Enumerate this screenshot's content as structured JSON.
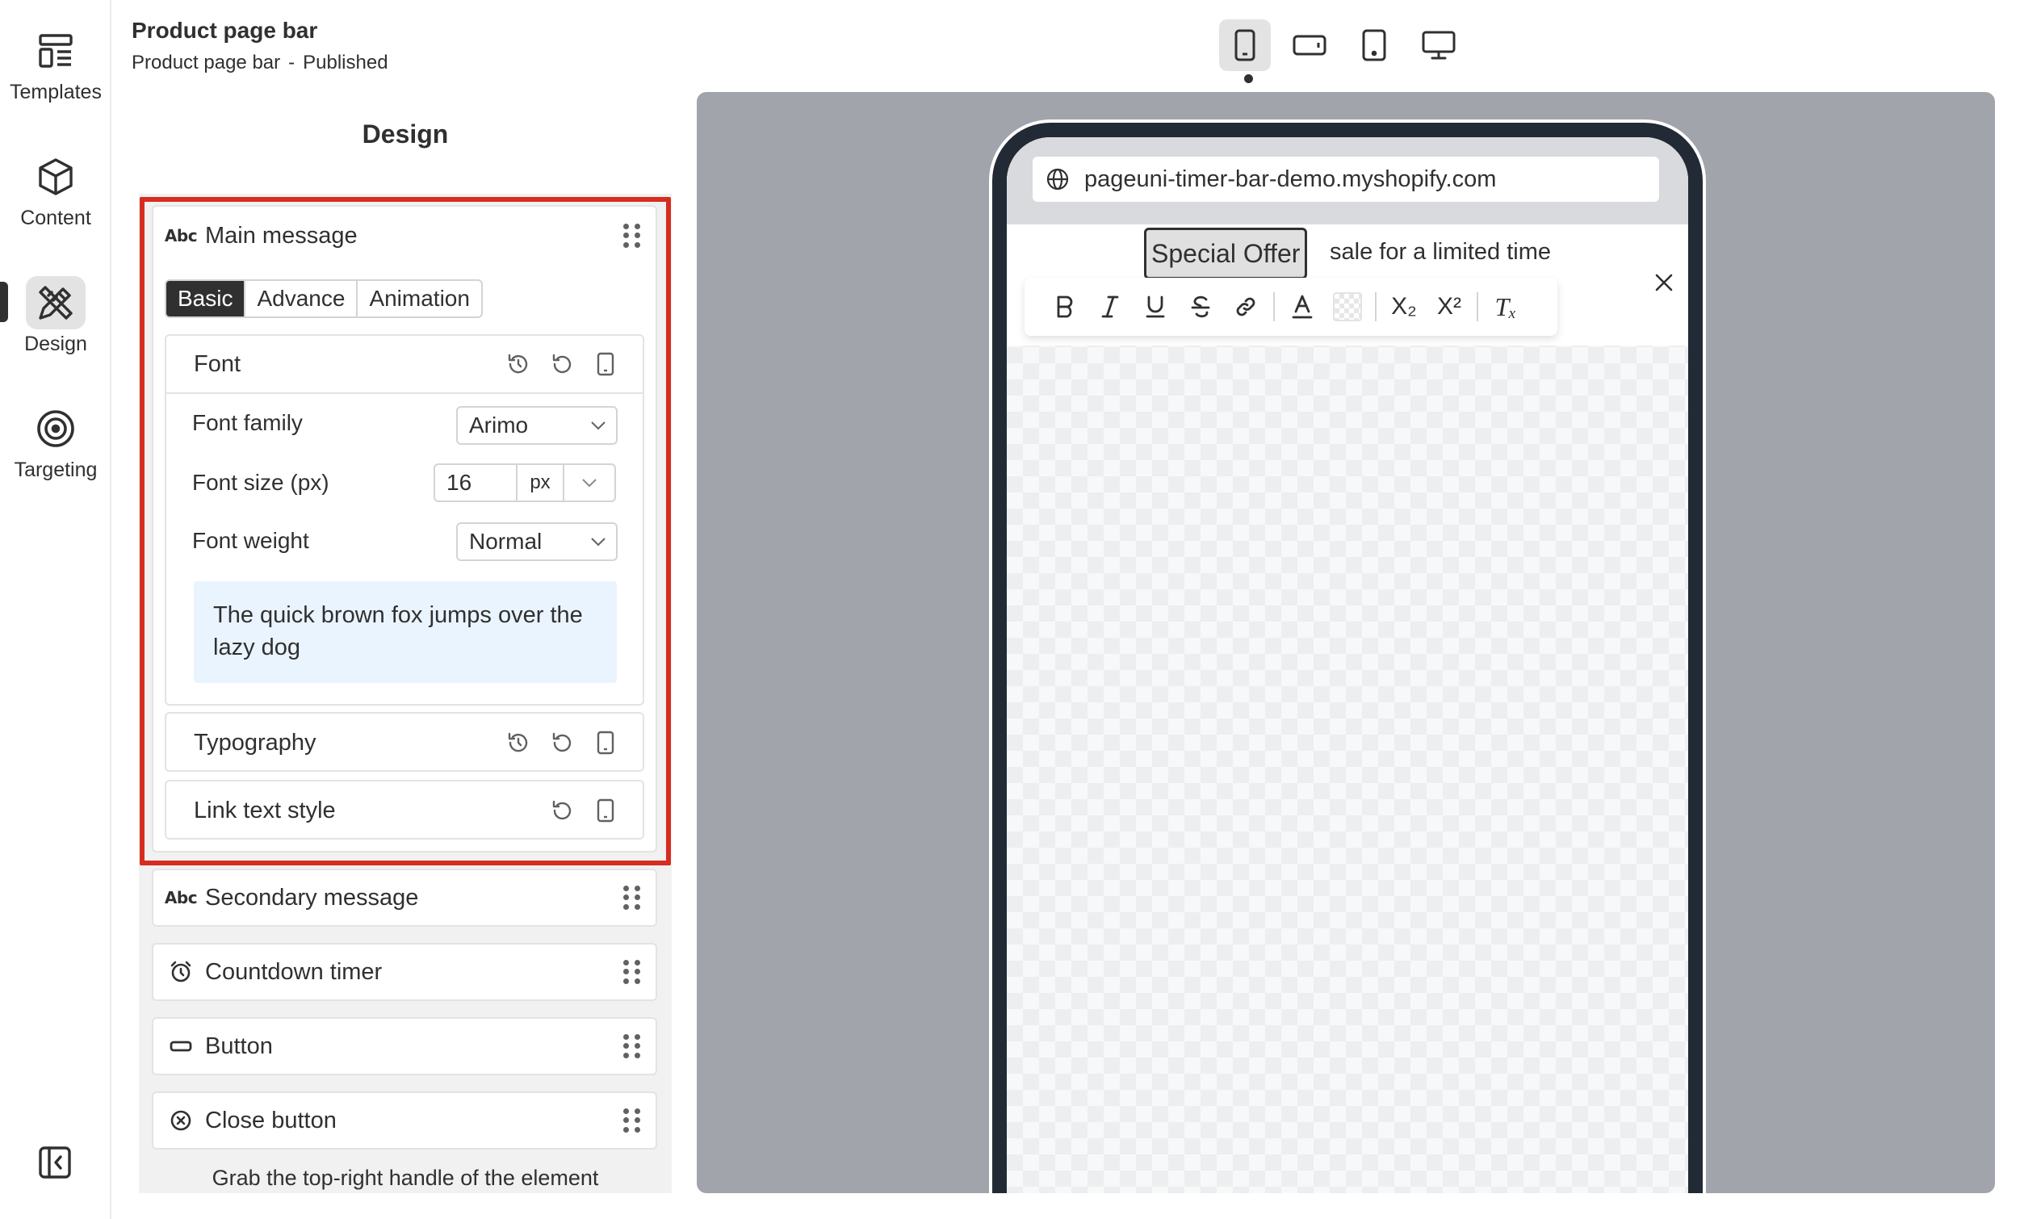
{
  "nav": {
    "items": [
      {
        "label": "Templates",
        "icon": "templates-icon"
      },
      {
        "label": "Content",
        "icon": "cube-icon"
      },
      {
        "label": "Design",
        "icon": "design-tools-icon",
        "active": true
      },
      {
        "label": "Targeting",
        "icon": "target-icon"
      }
    ],
    "collapse_icon": "sidebar-collapse-icon"
  },
  "header": {
    "title": "Product page bar",
    "subtitle_name": "Product page bar",
    "subtitle_sep": "-",
    "subtitle_status": "Published"
  },
  "panel": {
    "section_title": "Design",
    "main_message": {
      "title": "Main message",
      "icon": "abc-text-icon",
      "icon_text": "Abc",
      "tabs": [
        "Basic",
        "Advance",
        "Animation"
      ],
      "active_tab": "Basic",
      "font": {
        "title": "Font",
        "family_label": "Font family",
        "family_value": "Arimo",
        "size_label": "Font size (px)",
        "size_value": "16",
        "size_unit": "px",
        "weight_label": "Font weight",
        "weight_value": "Normal",
        "preview_text": "The quick brown fox jumps over the lazy dog"
      },
      "typography_title": "Typography",
      "link_style_title": "Link text style"
    },
    "other_elements": [
      {
        "title": "Secondary message",
        "icon": "abc-text-icon",
        "icon_text": "Abc"
      },
      {
        "title": "Countdown timer",
        "icon": "alarm-clock-icon"
      },
      {
        "title": "Button",
        "icon": "button-shape-icon"
      },
      {
        "title": "Close button",
        "icon": "close-circle-icon"
      }
    ],
    "help_text": "Grab the top-right handle of the element"
  },
  "devices": [
    "mobile",
    "landscape-mobile",
    "tablet",
    "desktop"
  ],
  "active_device": "mobile",
  "preview": {
    "url": "pageuni-timer-bar-demo.myshopify.com",
    "offer_text": "Special Offer",
    "message_rest": "sale for a limited time"
  },
  "toolbar": {
    "bold": "B",
    "italic": "I",
    "underline": "U",
    "strike": "S",
    "text_color": "A",
    "subscript": "X₂",
    "superscript": "X²",
    "clear": "Tₓ"
  },
  "colors": {
    "accent_border": "#d72c20",
    "active_tab": "#303030",
    "canvas": "#a1a4ab",
    "phone_frame": "#222a35",
    "preview_box": "#eaf4ff"
  }
}
